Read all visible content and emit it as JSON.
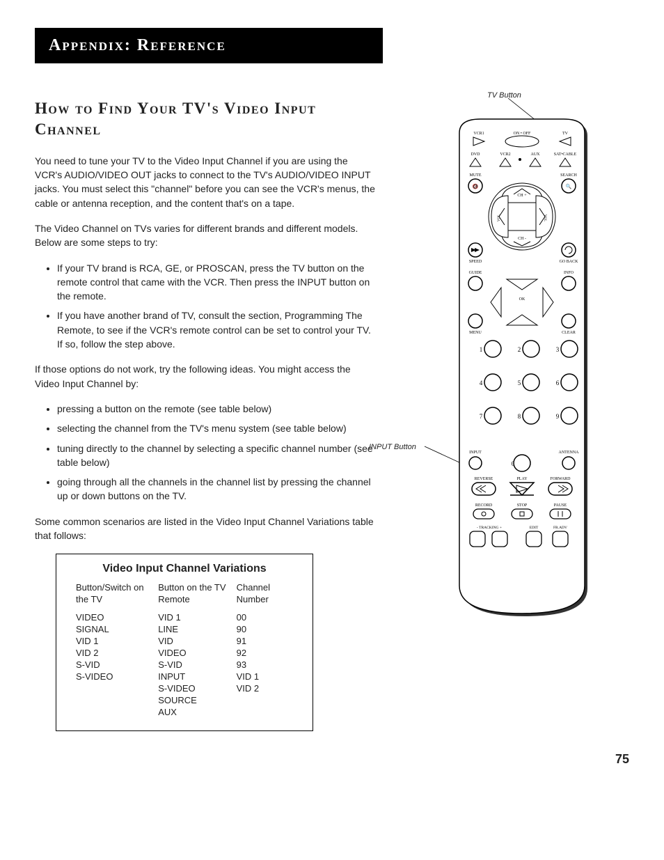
{
  "header": "Appendix: Reference",
  "section_title": "How to Find Your TV's Video Input Channel",
  "paragraphs": {
    "p1": "You need to tune your TV to the Video Input Channel if you are using the VCR's AUDIO/VIDEO OUT jacks to connect to the TV's AUDIO/VIDEO INPUT jacks. You must select this \"channel\" before you can see the VCR's menus, the cable or antenna reception, and the content that's on a tape.",
    "p2": "The Video Channel on TVs varies for different brands and different models. Below are some steps to try:",
    "p3": "If those options do not work, try the following ideas. You might access the Video Input Channel by:",
    "p4": "Some common scenarios are listed in the Video Input Channel Variations table that follows:"
  },
  "bullets1": [
    "If your TV brand is RCA, GE, or PROSCAN, press the TV button on the remote control that came with the VCR. Then press the INPUT button on the remote.",
    "If you have another brand of TV, consult the section, Programming The Remote, to see if the VCR's remote control can be set to control your TV. If so, follow the step above."
  ],
  "bullets2": [
    "pressing a button on the remote (see table below)",
    "selecting the channel from the TV's menu system (see table below)",
    "tuning directly to the channel by selecting a specific channel number (see table below)",
    "going through all the channels in the channel list by pressing the channel up or down buttons on the TV."
  ],
  "table": {
    "title": "Video Input Channel Variations",
    "headers": [
      "Button/Switch on the TV",
      "Button on the TV Remote",
      "Channel Number"
    ],
    "rows": [
      [
        "VIDEO",
        "VID 1",
        "00"
      ],
      [
        "SIGNAL",
        "LINE",
        "90"
      ],
      [
        "VID 1",
        "VID",
        "91"
      ],
      [
        "VID 2",
        "VIDEO",
        "92"
      ],
      [
        "S-VID",
        "S-VID",
        "93"
      ],
      [
        "S-VIDEO",
        "INPUT",
        "VID 1"
      ],
      [
        "",
        "S-VIDEO",
        "VID 2"
      ],
      [
        "",
        "SOURCE",
        ""
      ],
      [
        "",
        "AUX",
        ""
      ]
    ]
  },
  "page_number": "75",
  "callouts": {
    "tv_button": "TV Button",
    "input_button": "INPUT Button"
  },
  "remote_labels": {
    "vcr1": "VCR1",
    "on_off": "ON • OFF",
    "tv": "TV",
    "dvd": "DVD",
    "vcr2": "VCR2",
    "aux": "AUX",
    "sat_cable": "SAT•CABLE",
    "mute": "MUTE",
    "search": "SEARCH",
    "ch_plus": "CH +",
    "ch_minus": "CH -",
    "vol": "VOL",
    "speed": "SPEED",
    "go_back": "GO BACK",
    "guide": "GUIDE",
    "info": "INFO",
    "ok": "OK",
    "menu": "MENU",
    "clear": "CLEAR",
    "input": "INPUT",
    "antenna": "ANTENNA",
    "reverse": "REVERSE",
    "play": "PLAY",
    "forward": "FORWARD",
    "record": "RECORD",
    "stop": "STOP",
    "pause": "PAUSE",
    "tracking": "- TRACKING +",
    "edit": "EDIT",
    "fr_adv": "FR.ADV"
  }
}
